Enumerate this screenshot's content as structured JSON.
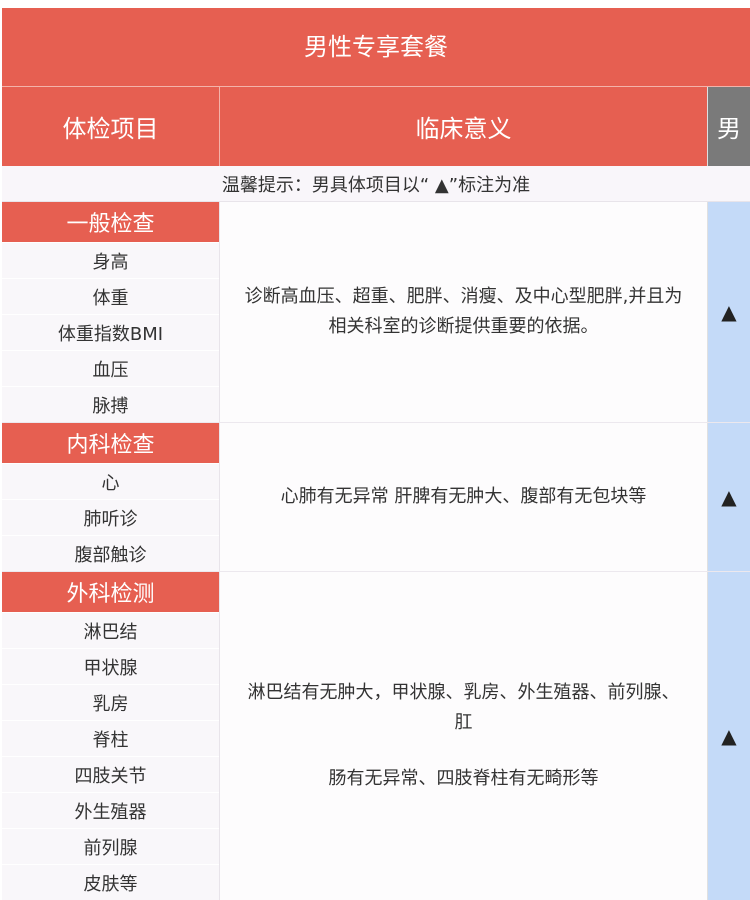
{
  "title": "男性专享套餐",
  "header": {
    "item": "体检项目",
    "meaning": "临床意义",
    "gender": "男"
  },
  "tip": "温馨提示：男具体项目以“ ▲”标注为准",
  "sections": [
    {
      "heading": "一般检查",
      "items": [
        "身高",
        "体重",
        "体重指数BMI",
        "血压",
        "脉搏"
      ],
      "meaning": [
        "诊断高血压、超重、肥胖、消瘦、及中心型肥胖,并且为",
        "相关科室的诊断提供重要的依据。"
      ],
      "mark": "▲"
    },
    {
      "heading": "内科检查",
      "items": [
        "心",
        "肺听诊",
        "腹部触诊"
      ],
      "meaning": [
        "心肺有无异常 肝脾有无肿大、腹部有无包块等"
      ],
      "mark": "▲"
    },
    {
      "heading": "外科检测",
      "items": [
        "淋巴结",
        "甲状腺",
        "乳房",
        "脊柱",
        "四肢关节",
        "外生殖器",
        "前列腺",
        "皮肤等"
      ],
      "meaning": [
        "淋巴结有无肿大，甲状腺、乳房、外生殖器、前列腺、",
        "肛"
      ],
      "meaning_extra": "肠有无异常、四肢脊柱有无畸形等",
      "mark": "▲"
    }
  ]
}
